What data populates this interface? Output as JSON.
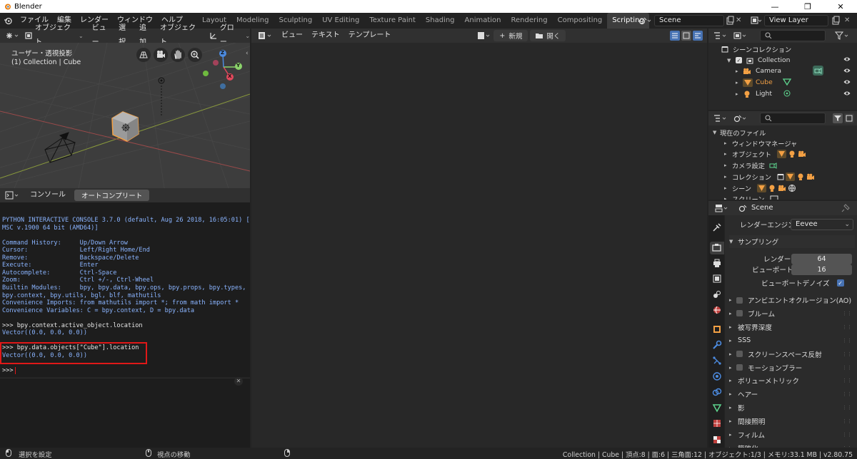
{
  "window": {
    "title": "Blender",
    "minimize": "—",
    "maximize": "❐",
    "close": "✕"
  },
  "menu": [
    "ファイル",
    "編集",
    "レンダー",
    "ウィンドウ",
    "ヘルプ"
  ],
  "workspaces": [
    "Layout",
    "Modeling",
    "Sculpting",
    "UV Editing",
    "Texture Paint",
    "Shading",
    "Animation",
    "Rendering",
    "Compositing",
    "Scripting",
    "+"
  ],
  "active_workspace": "Scripting",
  "scene": {
    "name": "Scene",
    "view_layer": "View Layer"
  },
  "viewport": {
    "header": {
      "mode": "オブジェクト...",
      "view": "ビュー",
      "select": "選択",
      "add": "追加",
      "object": "オブジェクト",
      "transform": "グロー..."
    },
    "overlay_title": "ユーザー・透視投影",
    "overlay_sub": "(1) Collection | Cube",
    "gizmo": {
      "x": "X",
      "y": "Y",
      "z": "Z"
    }
  },
  "console": {
    "tabs": [
      "コンソール",
      "オートコンプリート"
    ],
    "lines": [
      {
        "t": "PYTHON INTERACTIVE CONSOLE 3.7.0 (default, Aug 26 2018, 16:05:01) [",
        "c": "blue"
      },
      {
        "t": "MSC v.1900 64 bit (AMD64)]",
        "c": "blue"
      },
      {
        "t": "",
        "c": "blue"
      },
      {
        "t": "Command History:     Up/Down Arrow",
        "c": "blue"
      },
      {
        "t": "Cursor:              Left/Right Home/End",
        "c": "blue"
      },
      {
        "t": "Remove:              Backspace/Delete",
        "c": "blue"
      },
      {
        "t": "Execute:             Enter",
        "c": "blue"
      },
      {
        "t": "Autocomplete:        Ctrl-Space",
        "c": "blue"
      },
      {
        "t": "Zoom:                Ctrl +/-, Ctrl-Wheel",
        "c": "blue"
      },
      {
        "t": "Builtin Modules:     bpy, bpy.data, bpy.ops, bpy.props, bpy.types,",
        "c": "blue"
      },
      {
        "t": "bpy.context, bpy.utils, bgl, blf, mathutils",
        "c": "blue"
      },
      {
        "t": "Convenience Imports: from mathutils import *; from math import *",
        "c": "blue"
      },
      {
        "t": "Convenience Variables: C = bpy.context, D = bpy.data",
        "c": "blue"
      },
      {
        "t": "",
        "c": "blue"
      },
      {
        "t": ">>> bpy.context.active_object.location",
        "c": "white"
      },
      {
        "t": "Vector((0.0, 0.0, 0.0))",
        "c": "blue"
      },
      {
        "t": "",
        "c": "blue"
      },
      {
        "t": ">>> bpy.data.objects[\"Cube\"].location",
        "c": "white"
      },
      {
        "t": "Vector((0.0, 0.0, 0.0))",
        "c": "blue"
      },
      {
        "t": "",
        "c": "blue"
      },
      {
        "t": ">>> ",
        "c": "white"
      }
    ]
  },
  "texteditor": {
    "view": "ビュー",
    "text": "テキスト",
    "template": "テンプレート",
    "new": "新規",
    "open": "開く"
  },
  "outliner": {
    "rows": [
      "シーンコレクション",
      "Collection",
      "Camera",
      "Cube",
      "Light"
    ]
  },
  "blendfile": {
    "rows": [
      "現在のファイル",
      "ウィンドウマネージャ",
      "オブジェクト",
      "カメラ設定",
      "コレクション",
      "シーン",
      "スクリーン"
    ]
  },
  "properties": {
    "context": "Scene",
    "render_engine_label": "レンダーエンジン",
    "render_engine": "Eevee",
    "sampling": "サンプリング",
    "render_label": "レンダー",
    "render_samples": "64",
    "viewport_label": "ビューポート",
    "viewport_samples": "16",
    "viewport_denoise": "ビューポートデノイズ",
    "panels": [
      {
        "label": "アンビエントオクルージョン(AO)",
        "check": true
      },
      {
        "label": "ブルーム",
        "check": true
      },
      {
        "label": "被写界深度",
        "check": false
      },
      {
        "label": "SSS",
        "check": false
      },
      {
        "label": "スクリーンスペース反射",
        "check": true
      },
      {
        "label": "モーションブラー",
        "check": true
      },
      {
        "label": "ボリューメトリック",
        "check": false
      },
      {
        "label": "ヘアー",
        "check": false
      },
      {
        "label": "影",
        "check": false
      },
      {
        "label": "間接照明",
        "check": false
      },
      {
        "label": "フィルム",
        "check": false
      },
      {
        "label": "簡略化",
        "check": false
      }
    ]
  },
  "statusbar": {
    "left1": "選択を設定",
    "left2": "視点の移動",
    "right": "Collection | Cube | 頂点:8 | 面:6 | 三角面:12 | オブジェクト:1/3 | メモリ:33.1 MB | v2.80.75"
  },
  "colors": {
    "accent": "#4772b3",
    "highlight": "#e01818",
    "orange": "#f3a044",
    "green": "#8bd36b"
  }
}
